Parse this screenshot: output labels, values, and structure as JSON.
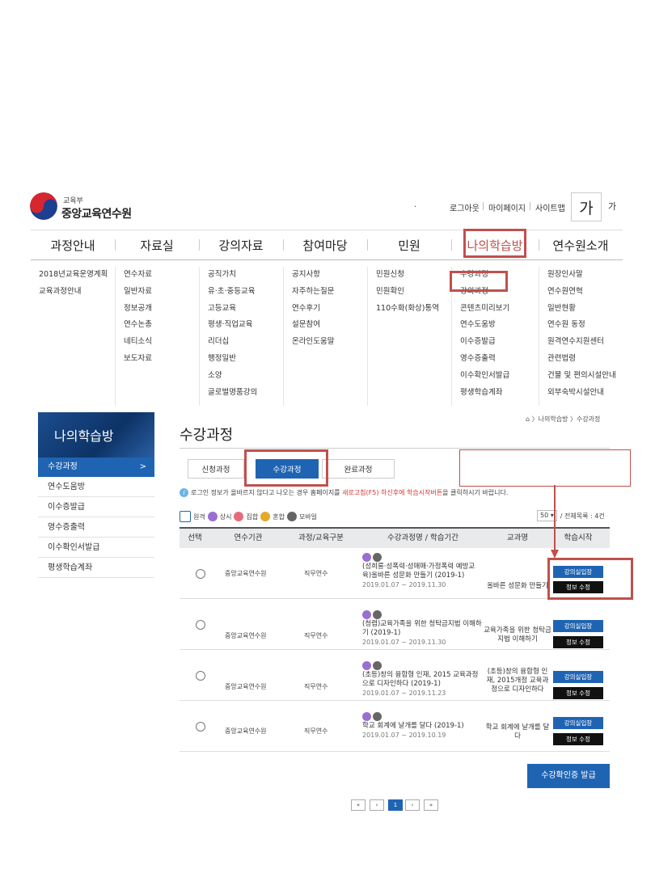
{
  "header": {
    "logo_small": "교육부",
    "logo_big": "중앙교육연수원",
    "dot": ".",
    "util": [
      "로그아웃",
      "마이페이지",
      "사이트맵"
    ],
    "font_large": "가",
    "font_small": "가"
  },
  "gnb": [
    {
      "label": "과정안내",
      "links": [
        "2018년교육운영계획",
        "교육과정안내"
      ]
    },
    {
      "label": "자료실",
      "links": [
        "연수자료",
        "일반자료",
        "정보공개",
        "연수논총",
        "네티소식",
        "보도자료"
      ]
    },
    {
      "label": "강의자료",
      "links": [
        "공직가치",
        "유·초·중등교육",
        "고등교육",
        "평생·직업교육",
        "리더십",
        "행정일반",
        "소양",
        "글로벌명품강의"
      ]
    },
    {
      "label": "참여마당",
      "links": [
        "공지사항",
        "자주하는질문",
        "연수후기",
        "설문참여",
        "온라인도움말"
      ]
    },
    {
      "label": "민원",
      "links": [
        "민원신청",
        "민원확인",
        "110수화(화상)통역"
      ]
    },
    {
      "label": "나의학습방",
      "links": [
        "수강과정",
        "강의과정",
        "콘텐츠미리보기",
        "연수도움방",
        "이수증발급",
        "영수증출력",
        "이수확인서발급",
        "평생학습계좌"
      ]
    },
    {
      "label": "연수원소개",
      "links": [
        "원장인사말",
        "연수원연혁",
        "일반현황",
        "연수원 동정",
        "원격연수지원센터",
        "관련법령",
        "건물 및 편의시설안내",
        "외부숙박시설안내"
      ]
    }
  ],
  "sidebar": {
    "title": "나의학습방",
    "items": [
      "수강과정",
      "연수도움방",
      "이수증발급",
      "영수증출력",
      "이수확인서발급",
      "평생학습계좌"
    ],
    "arrow": ">"
  },
  "content": {
    "title": "수강과정",
    "breadcrumb": "〉나의학습방 〉수강과정",
    "tabs": [
      "신청과정",
      "수강과정",
      "완료과정"
    ],
    "notice_a": "로그인 정보가 올바르지 않다고 나오는 경우 홈페이지를 ",
    "notice_red": "새로고침(F5) 하신후에 학습시작버튼",
    "notice_b": "을 클릭하시기 바랍니다.",
    "legend": [
      "원격",
      "상시",
      "집합",
      "혼합",
      "모바일"
    ],
    "perpage": "50",
    "total": "/ 전체목록 : 4건",
    "headers": [
      "선택",
      "연수기관",
      "과정/교육구분",
      "수강과정명 / 학습기간",
      "교과명",
      "학습시작"
    ],
    "rows": [
      {
        "org": "중앙교육연수원",
        "type": "직무연수",
        "title": "(성희롱·성폭력·성매매·가정폭력 예방교육)올바른 성문화 만들기 (2019-1)",
        "period": "2019.01.07 ~ 2019.11.30",
        "subject": "올바른 성문화 만들기",
        "btn1": "강의실입장",
        "btn2": "정보 수정"
      },
      {
        "org": "중앙교육연수원",
        "type": "직무연수",
        "title": "(청렴)교육가족을 위한 청탁금지법 이해하기 (2019-1)",
        "period": "2019.01.07 ~ 2019.11.30",
        "subject": "교육가족을 위한 청탁금지법 이해하기",
        "btn1": "강의실입장",
        "btn2": "정보 수정"
      },
      {
        "org": "중앙교육연수원",
        "type": "직무연수",
        "title": "(초등)창의 융합형 인재, 2015 교육과정으로 디자인하다 (2019-1)",
        "period": "2019.01.07 ~ 2019.11.23",
        "subject": "(초등)창의 융합형 인재, 2015개정 교육과정으로 디자인하다",
        "btn1": "강의실입장",
        "btn2": "정보 수정"
      },
      {
        "org": "중앙교육연수원",
        "type": "직무연수",
        "title": "학교 회계에 날개를 달다 (2019-1)",
        "period": "2019.01.07 ~ 2019.10.19",
        "subject": "학교 회계에 날개를 달다",
        "btn1": "강의실입장",
        "btn2": "정보 수정"
      }
    ],
    "cert_button": "수강확인증 발급",
    "pager": [
      "«",
      "‹",
      "1",
      "›",
      "»"
    ]
  },
  "colors": {
    "accent": "#1f64b3",
    "highlight": "#c0504d"
  }
}
